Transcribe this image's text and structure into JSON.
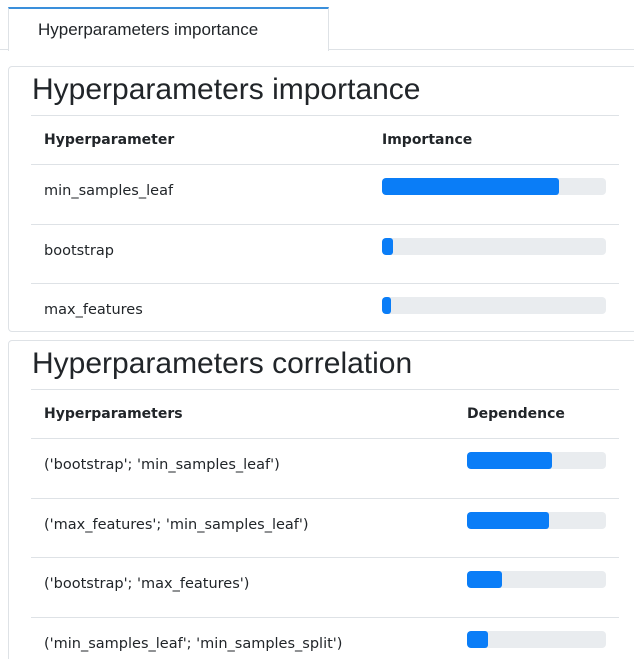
{
  "tabs": [
    {
      "label": "Hyperparameters importance",
      "active": true
    }
  ],
  "importance": {
    "title": "Hyperparameters importance",
    "headers": {
      "name": "Hyperparameter",
      "value": "Importance"
    },
    "rows": [
      {
        "name": "min_samples_leaf",
        "value": 0.79
      },
      {
        "name": "bootstrap",
        "value": 0.05
      },
      {
        "name": "max_features",
        "value": 0.04
      }
    ]
  },
  "correlation": {
    "title": "Hyperparameters correlation",
    "headers": {
      "name": "Hyperparameters",
      "value": "Dependence"
    },
    "rows": [
      {
        "name": "('bootstrap'; 'min_samples_leaf')",
        "value": 0.61
      },
      {
        "name": "('max_features'; 'min_samples_leaf')",
        "value": 0.59
      },
      {
        "name": "('bootstrap'; 'max_features')",
        "value": 0.25
      },
      {
        "name": "('min_samples_leaf'; 'min_samples_split')",
        "value": 0.15
      }
    ]
  },
  "colors": {
    "bar_fill": "#0a7df7",
    "bar_track": "#e9ecef",
    "tab_accent": "#3a8fdb",
    "border": "#dee2e6"
  }
}
